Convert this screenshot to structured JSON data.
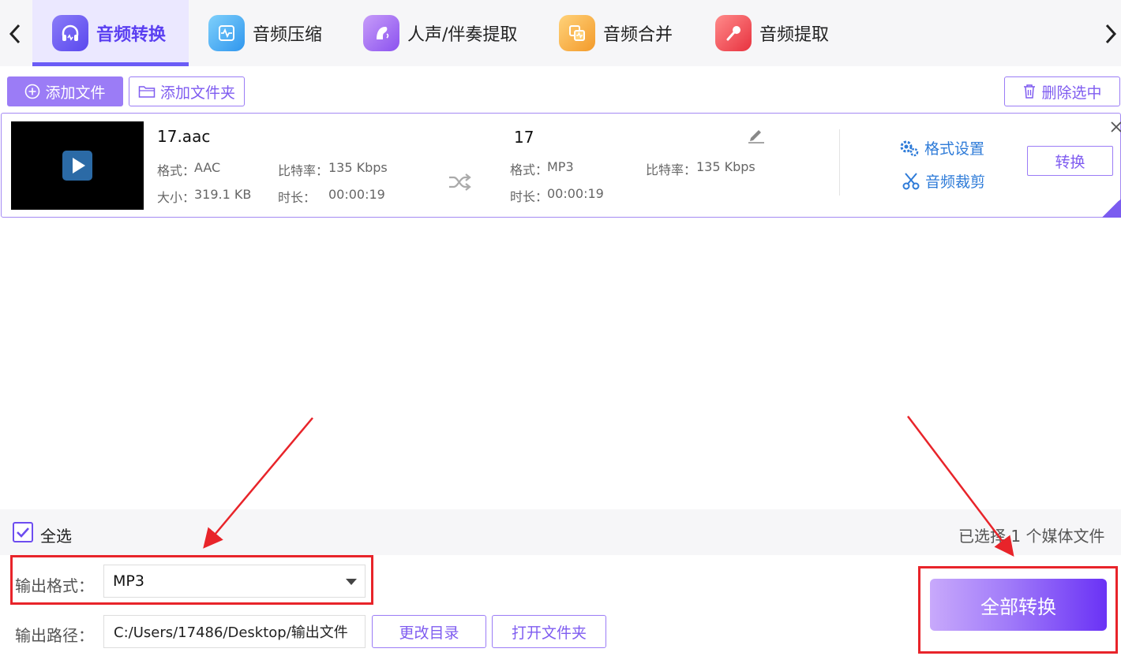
{
  "tabs": [
    {
      "label": "音频转换",
      "icon": "headphones-icon",
      "color": "#6b5cf6",
      "active": true
    },
    {
      "label": "音频压缩",
      "icon": "waveform-icon",
      "color": "#3fa9f5",
      "active": false
    },
    {
      "label": "人声/伴奏提取",
      "icon": "voice-icon",
      "color": "#a86bf5",
      "active": false
    },
    {
      "label": "音频合并",
      "icon": "merge-icon",
      "color": "#f7b03a",
      "active": false
    },
    {
      "label": "音频提取",
      "icon": "microphone-icon",
      "color": "#f2545b",
      "active": false
    }
  ],
  "toolbar": {
    "add_file": "添加文件",
    "add_folder": "添加文件夹",
    "delete_selected": "删除选中"
  },
  "file": {
    "source_name": "17.aac",
    "source_format_label": "格式：",
    "source_format": "AAC",
    "source_bitrate_label": "比特率：",
    "source_bitrate": "135 Kbps",
    "source_size_label": "大小：",
    "source_size": "319.1 KB",
    "source_duration_label": "时长：",
    "source_duration": "00:00:19",
    "target_name": "17",
    "target_format_label": "格式：",
    "target_format": "MP3",
    "target_bitrate_label": "比特率：",
    "target_bitrate": "135 Kbps",
    "target_duration_label": "时长：",
    "target_duration": "00:00:19",
    "format_settings": "格式设置",
    "audio_trim": "音频裁剪",
    "convert": "转换"
  },
  "footer": {
    "select_all": "全选",
    "selected_count": "已选择 1 个媒体文件",
    "output_format_label": "输出格式：",
    "output_format": "MP3",
    "output_path_label": "输出路径：",
    "output_path": "C:/Users/17486/Desktop/输出文件",
    "change_dir": "更改目录",
    "open_folder": "打开文件夹",
    "convert_all": "全部转换"
  },
  "colors": {
    "accent": "#6b5cf6",
    "link": "#2e7bd8",
    "annotation": "#e8242a"
  }
}
